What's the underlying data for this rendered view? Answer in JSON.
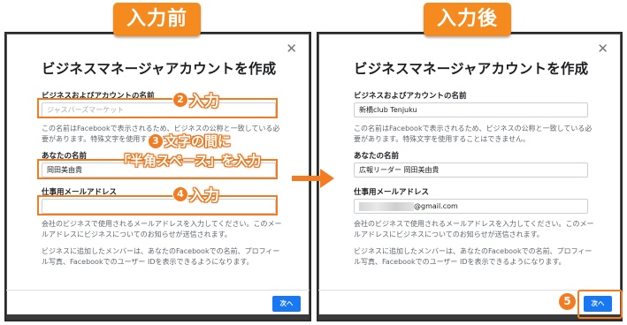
{
  "banners": {
    "before": "入力前",
    "after": "入力後"
  },
  "dialog": {
    "title": "ビジネスマネージャアカウントを作成",
    "close_icon": "close-icon",
    "business_label": "ビジネスおよびアカウントの名前",
    "business_placeholder": "ジャスパーズマーケット",
    "business_help": "この名前はFacebookで表示されるため、ビジネスの公称と一致している必要があります。特殊文字を使用することはできません。",
    "your_name_label": "あなたの名前",
    "work_email_label": "仕事用メールアドレス",
    "email_help": "会社のビジネスで使用されるメールアドレスを入力してください。このメールアドレスにビジネスについてのお知らせが送信されます。",
    "members_help": "ビジネスに追加したメンバーは、あなたのFacebookでの名前、プロフィール写真、Facebookでのユーザー IDを表示できるようになります。",
    "next_label": "次へ"
  },
  "before": {
    "your_name_value": "岡田美由貴"
  },
  "after": {
    "business_value": "新橋club Tenjuku",
    "your_name_value": "広報リーダー 岡田美由貴",
    "email_value": "@gmail.com"
  },
  "callouts": {
    "c2_num": "2",
    "c2_text": "入力",
    "c3_num": "3",
    "c3_text1": "文字の間に",
    "c3_text2": "「半角スペース」を入力",
    "c4_num": "4",
    "c4_text": "入力",
    "c5_num": "5"
  },
  "colors": {
    "accent": "#f47b20",
    "primary_button": "#1877f2"
  }
}
